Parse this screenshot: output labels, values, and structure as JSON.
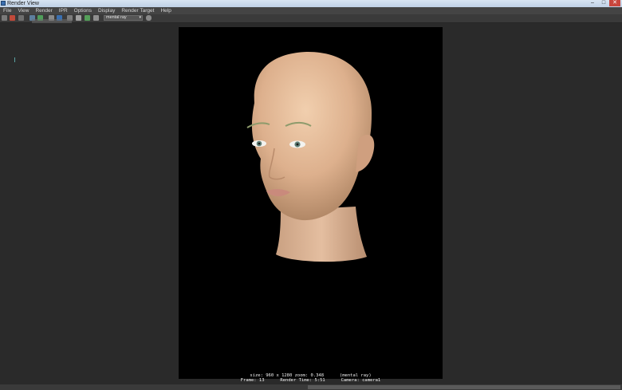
{
  "window": {
    "title": "Render View",
    "controls": {
      "minimize": "–",
      "maximize": "□",
      "close": "✕"
    }
  },
  "menu": {
    "items": [
      {
        "label": "File"
      },
      {
        "label": "View"
      },
      {
        "label": "Render"
      },
      {
        "label": "IPR"
      },
      {
        "label": "Options"
      },
      {
        "label": "Display"
      },
      {
        "label": "Render Target"
      },
      {
        "label": "Help"
      }
    ]
  },
  "toolbar": {
    "renderer": "mental ray",
    "dropdown_arrow": "▾"
  },
  "render": {
    "info_line1": "size: 960 x 1280 zoom: 0.348      (mental ray)",
    "info_line2": "Frame: 13      Render Time: 5:51      Camera: camera1"
  },
  "colors": {
    "background": "#2b2b2b",
    "menubar": "#444444",
    "toolbar": "#3a3a3a",
    "render_frame": "#000000",
    "skin": "#e3b896"
  }
}
